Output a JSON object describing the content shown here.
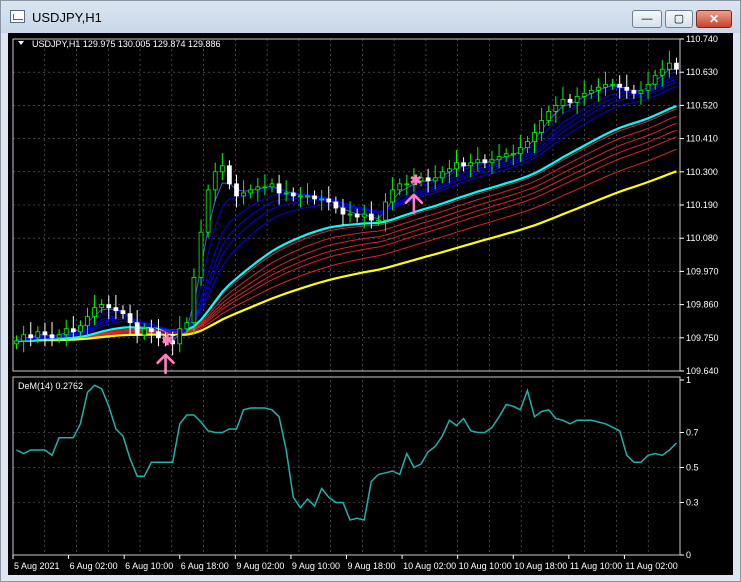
{
  "window": {
    "title": "USDJPY,H1",
    "minimize_glyph": "—",
    "maximize_glyph": "▢",
    "close_glyph": "✕",
    "icon": "chart-window-icon"
  },
  "colors": {
    "background": "#000000",
    "grid": "#c8c8c8",
    "bull_candle": "#00ff00",
    "bear_candle": "#ffffff",
    "fast_ribbon": "#0000ff",
    "fast_ribbon_edge": "#4a6bff",
    "slow_ribbon": "#ff2a2a",
    "cyan_ma": "#00ffff",
    "yellow_ma": "#ffff00",
    "signal": "#ff80c0",
    "demarker": "#20b2aa",
    "text": "#ffffff"
  },
  "main_chart": {
    "header": "USDJPY,H1  129.975 130.005 129.874 129.886",
    "price_levels": [
      "110.740",
      "110.630",
      "110.520",
      "110.410",
      "110.300",
      "110.190",
      "110.080",
      "109.970",
      "109.860",
      "109.750",
      "109.640"
    ]
  },
  "indicator": {
    "header": "DeM(14) 0.2762",
    "levels": [
      "1",
      "0.7",
      "0.5",
      "0.3",
      "0"
    ]
  },
  "time_axis": [
    "5 Aug 2021",
    "6 Aug 02:00",
    "6 Aug 10:00",
    "6 Aug 18:00",
    "9 Aug 02:00",
    "9 Aug 10:00",
    "9 Aug 18:00",
    "10 Aug 02:00",
    "10 Aug 10:00",
    "10 Aug 18:00",
    "11 Aug 10:00",
    "11 Aug 02:00"
  ],
  "chart_data": {
    "type": "candlestick",
    "symbol": "USDJPY",
    "timeframe": "H1",
    "ylim": [
      109.64,
      110.74
    ],
    "closes": [
      109.74,
      109.76,
      109.75,
      109.77,
      109.76,
      109.75,
      109.76,
      109.78,
      109.77,
      109.79,
      109.82,
      109.85,
      109.86,
      109.85,
      109.84,
      109.83,
      109.8,
      109.76,
      109.78,
      109.77,
      109.75,
      109.74,
      109.73,
      109.78,
      109.8,
      109.95,
      110.1,
      110.24,
      110.3,
      110.32,
      110.26,
      110.22,
      110.23,
      110.24,
      110.25,
      110.25,
      110.26,
      110.23,
      110.23,
      110.22,
      110.22,
      110.22,
      110.21,
      110.21,
      110.2,
      110.18,
      110.16,
      110.16,
      110.15,
      110.16,
      110.14,
      110.14,
      110.2,
      110.24,
      110.26,
      110.26,
      110.27,
      110.28,
      110.27,
      110.28,
      110.3,
      110.31,
      110.33,
      110.32,
      110.33,
      110.34,
      110.33,
      110.34,
      110.35,
      110.36,
      110.36,
      110.38,
      110.4,
      110.43,
      110.47,
      110.5,
      110.52,
      110.54,
      110.53,
      110.55,
      110.56,
      110.57,
      110.58,
      110.59,
      110.59,
      110.58,
      110.57,
      110.56,
      110.57,
      110.59,
      110.62,
      110.64,
      110.66,
      110.64
    ],
    "demarker": [
      0.6,
      0.58,
      0.6,
      0.6,
      0.6,
      0.57,
      0.67,
      0.67,
      0.67,
      0.75,
      0.93,
      0.97,
      0.95,
      0.85,
      0.72,
      0.68,
      0.55,
      0.45,
      0.45,
      0.53,
      0.53,
      0.53,
      0.53,
      0.75,
      0.8,
      0.8,
      0.76,
      0.71,
      0.7,
      0.7,
      0.72,
      0.72,
      0.83,
      0.84,
      0.84,
      0.84,
      0.83,
      0.79,
      0.6,
      0.33,
      0.27,
      0.32,
      0.28,
      0.38,
      0.33,
      0.3,
      0.3,
      0.2,
      0.21,
      0.2,
      0.42,
      0.46,
      0.47,
      0.48,
      0.46,
      0.58,
      0.5,
      0.52,
      0.59,
      0.62,
      0.68,
      0.77,
      0.74,
      0.78,
      0.71,
      0.7,
      0.7,
      0.73,
      0.79,
      0.86,
      0.85,
      0.83,
      0.94,
      0.79,
      0.82,
      0.83,
      0.78,
      0.77,
      0.75,
      0.77,
      0.77,
      0.77,
      0.76,
      0.75,
      0.73,
      0.71,
      0.57,
      0.53,
      0.53,
      0.57,
      0.58,
      0.57,
      0.6,
      0.64
    ],
    "demarker_ylim": [
      0,
      1
    ],
    "signals": [
      {
        "bar": 21,
        "type": "buy"
      },
      {
        "bar": 56,
        "type": "buy"
      }
    ],
    "fast_ribbon_periods": [
      3,
      5,
      8,
      10,
      12,
      15
    ],
    "slow_ribbon_periods": [
      30,
      35,
      40,
      45,
      50,
      60
    ],
    "cyan_period": 28,
    "yellow_period": 80
  }
}
